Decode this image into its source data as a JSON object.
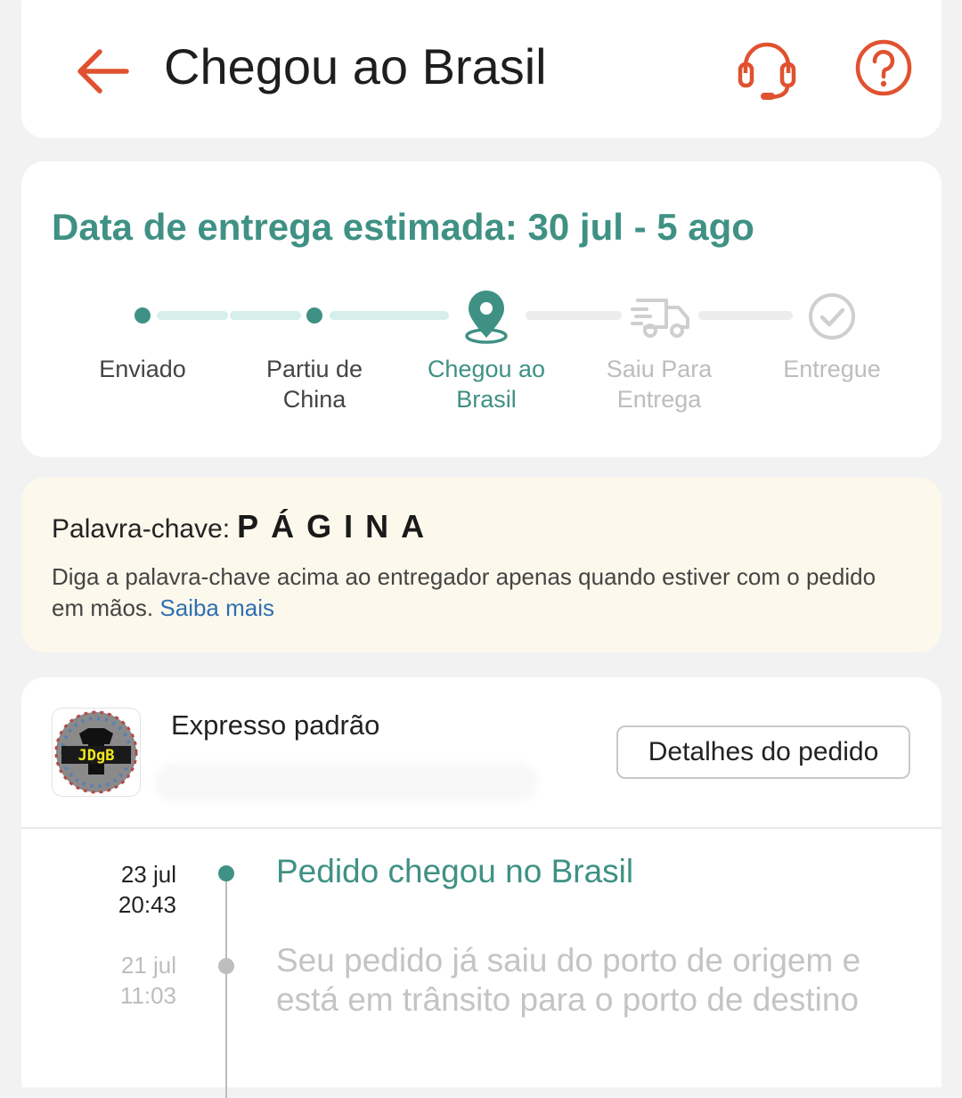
{
  "header": {
    "title": "Chegou ao Brasil",
    "back_icon": "arrow-left-icon",
    "support_icon": "headset-icon",
    "help_icon": "question-circle-icon",
    "accent_color": "#e0522f"
  },
  "tracking": {
    "estimate_text": "Data de entrega estimada: 30 jul - 5 ago",
    "accent_color": "#3f9184",
    "steps": [
      {
        "label_line1": "Enviado",
        "label_line2": "",
        "state": "done"
      },
      {
        "label_line1": "Partiu de",
        "label_line2": "China",
        "state": "done"
      },
      {
        "label_line1": "Chegou ao",
        "label_line2": "Brasil",
        "state": "current",
        "icon": "location-pin-icon"
      },
      {
        "label_line1": "Saiu Para",
        "label_line2": "Entrega",
        "state": "pending",
        "icon": "delivery-truck-icon"
      },
      {
        "label_line1": "Entregue",
        "label_line2": "",
        "state": "pending",
        "icon": "check-circle-icon"
      }
    ]
  },
  "keyword": {
    "label": "Palavra-chave:",
    "value": "PÁGINA",
    "description": "Diga a palavra-chave acima ao entregador apenas quando estiver com o pedido em mãos.",
    "link": "Saiba mais"
  },
  "shipment": {
    "method": "Expresso padrão",
    "details_button": "Detalhes do pedido",
    "store_logo_text": "JDgB",
    "events": [
      {
        "date": "23 jul",
        "time": "20:43",
        "text": "Pedido chegou no Brasil",
        "active": true
      },
      {
        "date": "21 jul",
        "time": "11:03",
        "text": "Seu pedido já saiu do porto de origem e está em trânsito para o porto de destino",
        "active": false
      }
    ]
  }
}
